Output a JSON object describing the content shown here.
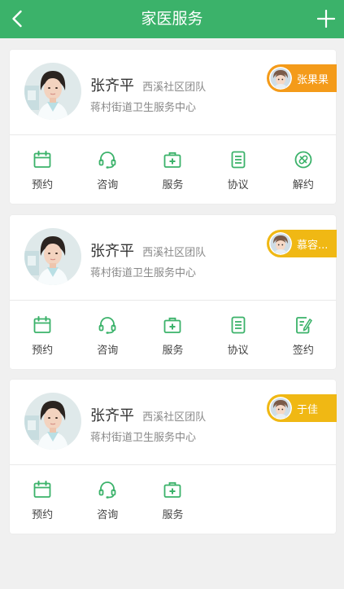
{
  "header": {
    "title": "家医服务",
    "back_icon": "chevron-left-icon",
    "add_icon": "plus-icon",
    "background": "#3bb26a"
  },
  "colors": {
    "accent": "#3bb26a",
    "tag_orange": "#f49b1a",
    "tag_yellow": "#f0b814"
  },
  "cards": [
    {
      "doctor_name": "张齐平",
      "team": "西溪社区团队",
      "center": "蒋村街道卫生服务中心",
      "member": {
        "name": "张果果",
        "color": "#f49b1a"
      },
      "actions": [
        {
          "label": "预约",
          "icon": "calendar-icon"
        },
        {
          "label": "咨询",
          "icon": "headset-icon"
        },
        {
          "label": "服务",
          "icon": "medical-kit-icon"
        },
        {
          "label": "协议",
          "icon": "document-icon"
        },
        {
          "label": "解约",
          "icon": "cancel-contract-icon"
        }
      ]
    },
    {
      "doctor_name": "张齐平",
      "team": "西溪社区团队",
      "center": "蒋村街道卫生服务中心",
      "member": {
        "name": "慕容...",
        "color": "#f0b814"
      },
      "actions": [
        {
          "label": "预约",
          "icon": "calendar-icon"
        },
        {
          "label": "咨询",
          "icon": "headset-icon"
        },
        {
          "label": "服务",
          "icon": "medical-kit-icon"
        },
        {
          "label": "协议",
          "icon": "document-icon"
        },
        {
          "label": "签约",
          "icon": "sign-contract-icon"
        }
      ]
    },
    {
      "doctor_name": "张齐平",
      "team": "西溪社区团队",
      "center": "蒋村街道卫生服务中心",
      "member": {
        "name": "于佳",
        "color": "#f0b814"
      },
      "actions": [
        {
          "label": "预约",
          "icon": "calendar-icon"
        },
        {
          "label": "咨询",
          "icon": "headset-icon"
        },
        {
          "label": "服务",
          "icon": "medical-kit-icon"
        }
      ]
    }
  ]
}
